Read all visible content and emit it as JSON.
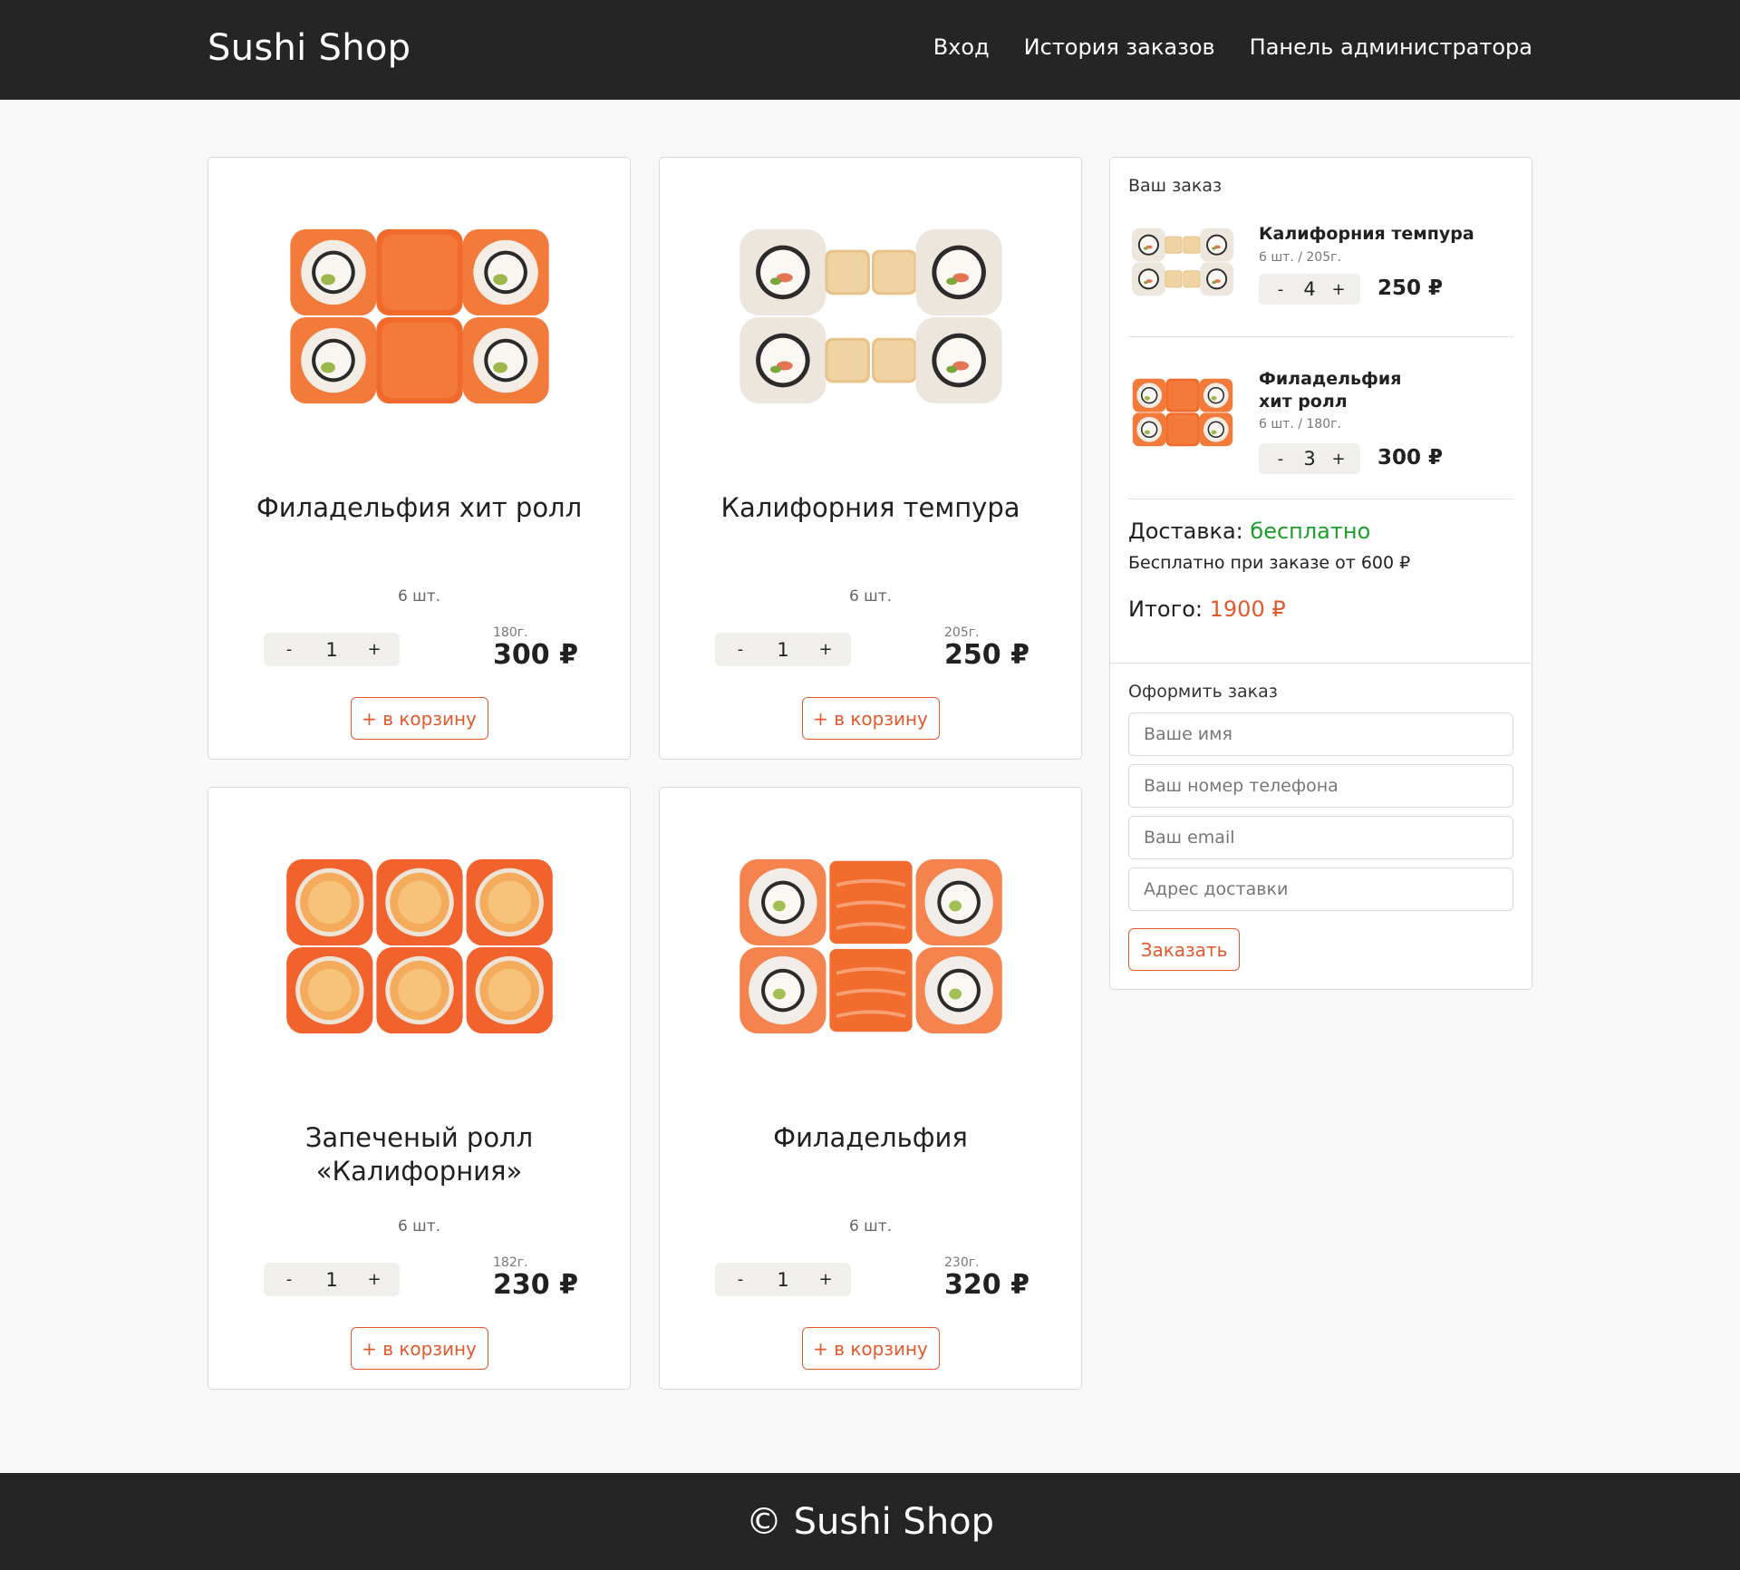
{
  "header": {
    "brand": "Sushi Shop",
    "nav": [
      "Вход",
      "История заказов",
      "Панель администратора"
    ]
  },
  "products": [
    {
      "title": "Филадельфия хит ролл",
      "pieces": "6 шт.",
      "qty": "1",
      "weight": "180г.",
      "price": "300 ₽",
      "cart_label": "+ в корзину",
      "image": "philadelphia-hit-roll-image"
    },
    {
      "title": "Калифорния темпура",
      "pieces": "6 шт.",
      "qty": "1",
      "weight": "205г.",
      "price": "250 ₽",
      "cart_label": "+ в корзину",
      "image": "california-tempura-image"
    },
    {
      "title": "Запеченый ролл «Калифорния»",
      "pieces": "6 шт.",
      "qty": "1",
      "weight": "182г.",
      "price": "230 ₽",
      "cart_label": "+ в корзину",
      "image": "baked-california-roll-image"
    },
    {
      "title": "Филадельфия",
      "pieces": "6 шт.",
      "qty": "1",
      "weight": "230г.",
      "price": "320 ₽",
      "cart_label": "+ в корзину",
      "image": "philadelphia-roll-image"
    }
  ],
  "stepper": {
    "minus": "-",
    "plus": "+"
  },
  "order": {
    "title": "Ваш заказ",
    "items": [
      {
        "name": "Калифорния темпура",
        "meta": "6 шт. / 205г.",
        "qty": "4",
        "price": "250 ₽"
      },
      {
        "name": "Филадельфия хит ролл",
        "meta": "6 шт. / 180г.",
        "qty": "3",
        "price": "300 ₽"
      }
    ],
    "delivery_label": "Доставка:",
    "delivery_value": "бесплатно",
    "delivery_note": "Бесплатно при заказе от 600 ₽",
    "total_label": "Итого:",
    "total_value": "1900 ₽"
  },
  "checkout": {
    "title": "Оформить заказ",
    "name_placeholder": "Ваше имя",
    "phone_placeholder": "Ваш номер телефона",
    "email_placeholder": "Ваш email",
    "address_placeholder": "Адрес доставки",
    "submit_label": "Заказать"
  },
  "footer": {
    "text": "© Sushi Shop"
  },
  "colors": {
    "accent": "#e2592c",
    "free": "#1ba02a",
    "header": "#252525"
  }
}
